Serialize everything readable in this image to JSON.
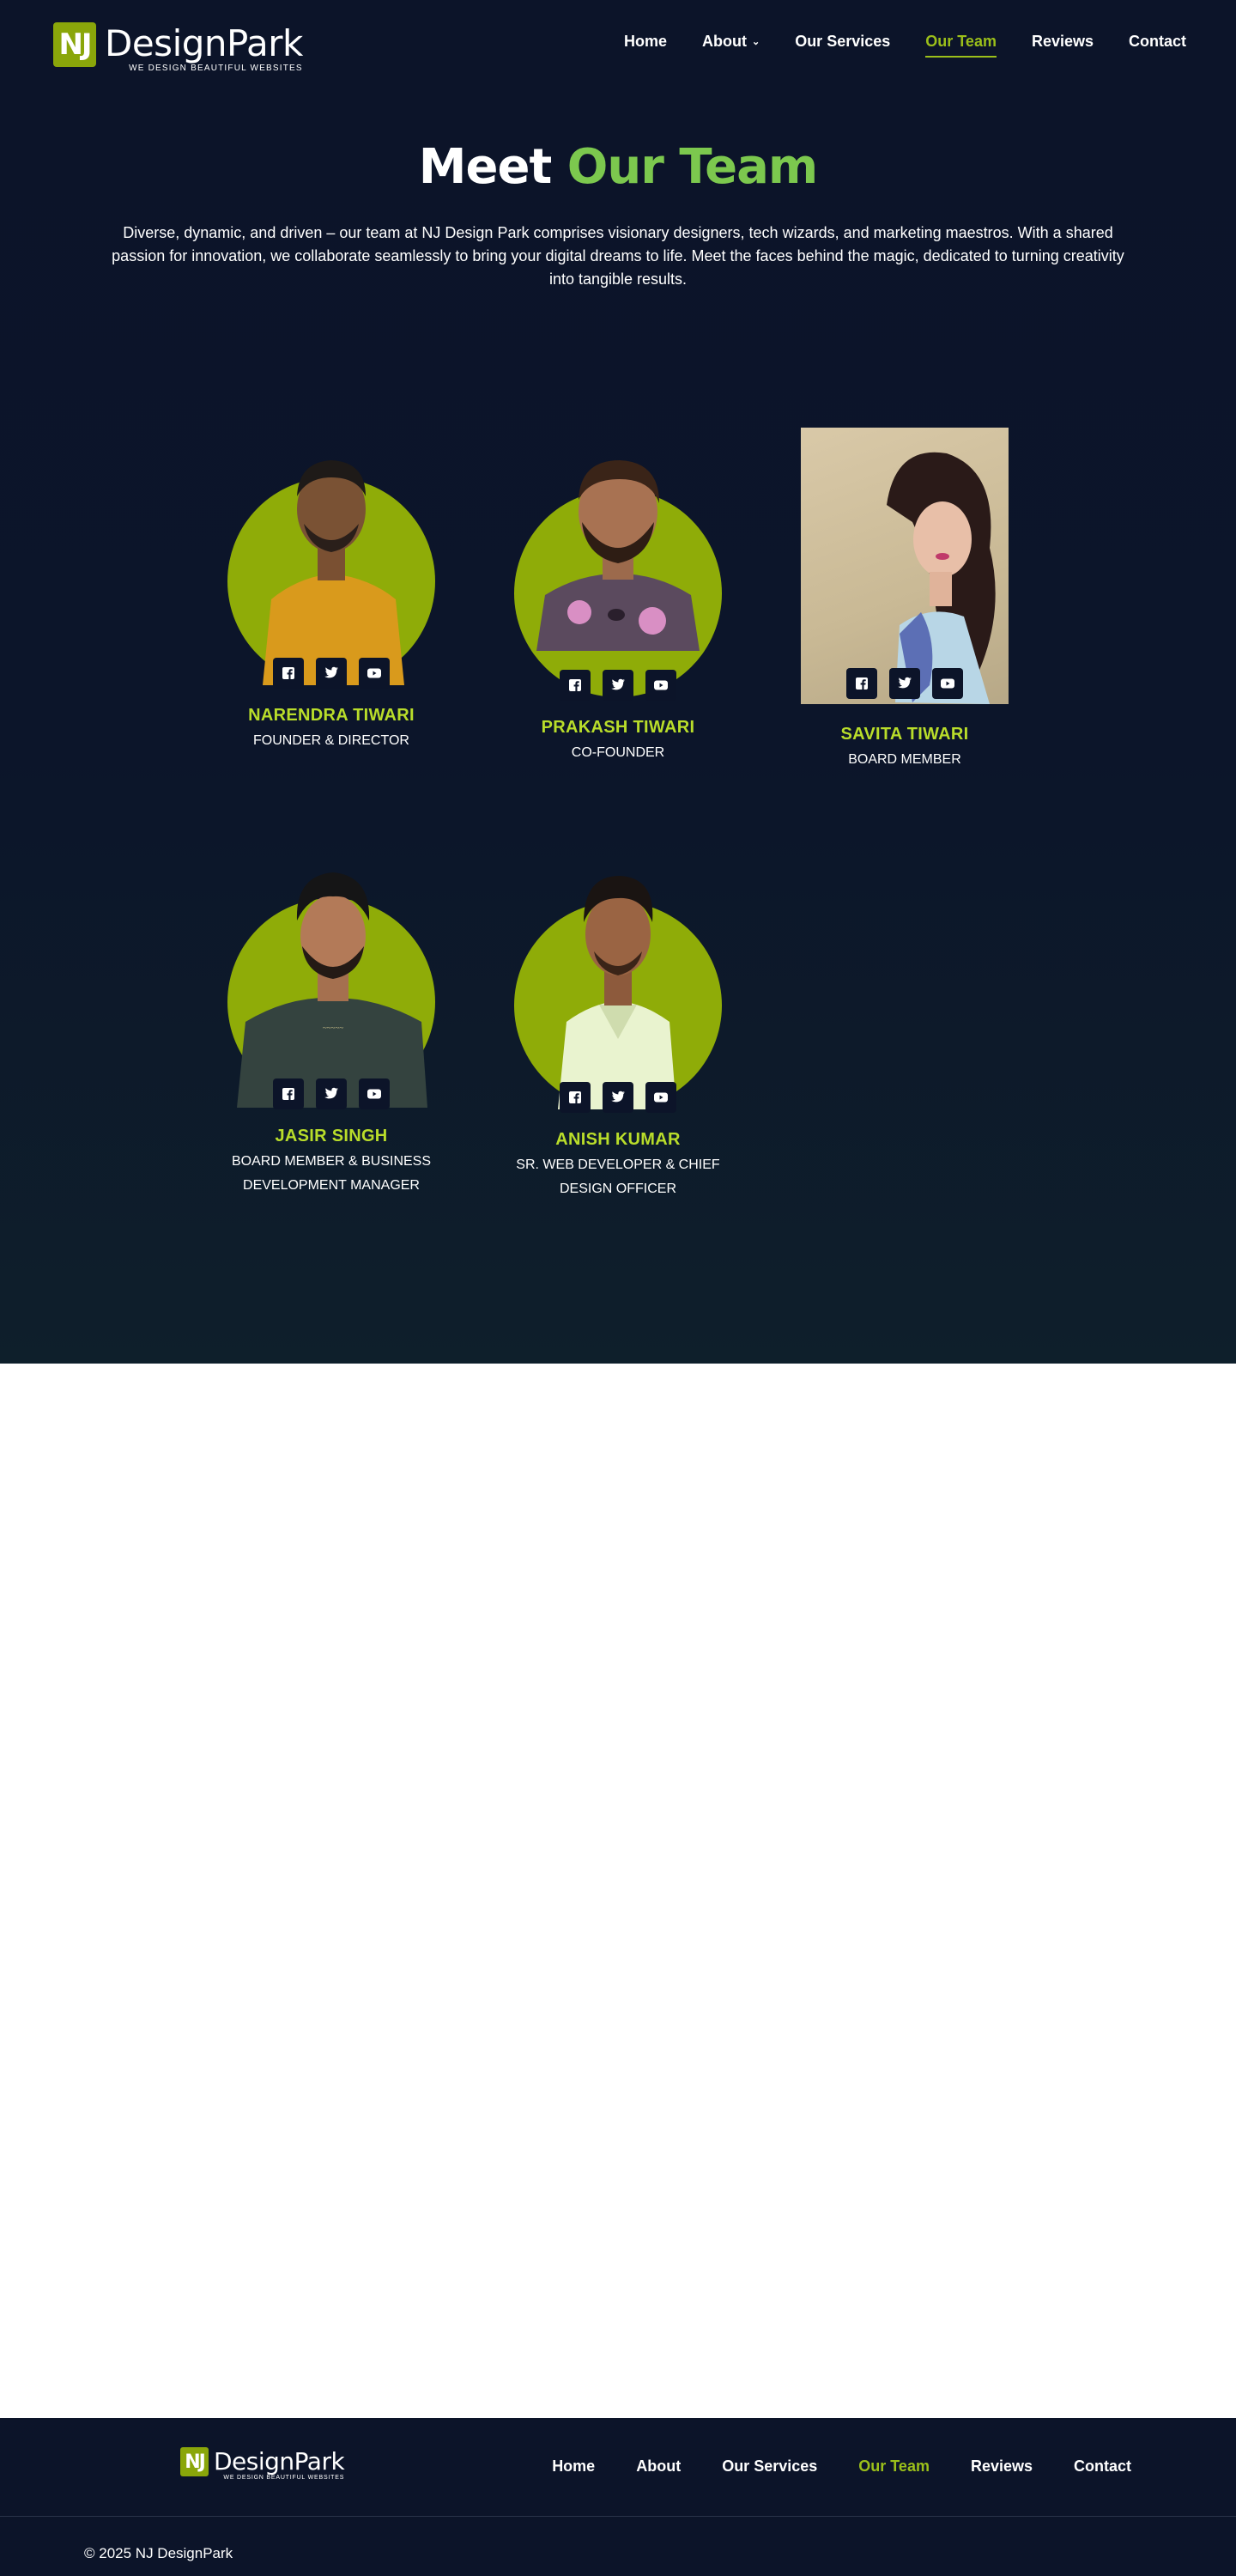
{
  "brand": {
    "mark": "NJ",
    "name": "DesignPark",
    "tagline": "WE DESIGN BEAUTIFUL WEBSITES"
  },
  "nav": [
    {
      "label": "Home"
    },
    {
      "label": "About"
    },
    {
      "label": "Our Services"
    },
    {
      "label": "Our Team",
      "active": true
    },
    {
      "label": "Reviews"
    },
    {
      "label": "Contact"
    }
  ],
  "hero": {
    "title_prefix": "Meet",
    "title_accent": "Our Team",
    "intro": "Diverse, dynamic, and driven – our team at NJ Design Park comprises visionary designers, tech wizards, and marketing maestros. With a shared passion for innovation, we collaborate seamlessly to bring your digital dreams to life. Meet the faces behind the magic, dedicated to turning creativity into tangible results."
  },
  "team": [
    {
      "name": "NARENDRA TIWARI",
      "role": "FOUNDER & DIRECTOR"
    },
    {
      "name": "PRAKASH TIWARI",
      "role": "CO-FOUNDER"
    },
    {
      "name": "SAVITA TIWARI",
      "role": "BOARD MEMBER"
    },
    {
      "name": "JASIR SINGH",
      "role": "BOARD MEMBER & BUSINESS DEVELOPMENT MANAGER"
    },
    {
      "name": "ANISH KUMAR",
      "role": "SR. WEB DEVELOPER & CHIEF DESIGN OFFICER"
    }
  ],
  "socials": [
    "facebook-icon",
    "twitter-icon",
    "youtube-icon"
  ],
  "footer": {
    "nav": [
      {
        "label": "Home"
      },
      {
        "label": "About"
      },
      {
        "label": "Our Services"
      },
      {
        "label": "Our Team",
        "active": true
      },
      {
        "label": "Reviews"
      },
      {
        "label": "Contact"
      }
    ],
    "copyright": "© 2025 NJ DesignPark"
  },
  "colors": {
    "background": "#0c1429",
    "accent": "#9bbf1a",
    "title_accent": "#7cc84e",
    "photo_circle": "#8fac08"
  }
}
